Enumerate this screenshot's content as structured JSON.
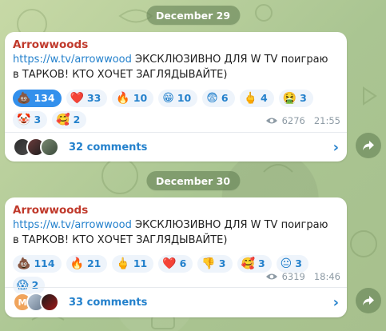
{
  "dates": [
    "December 29",
    "December 30"
  ],
  "posts": [
    {
      "author": "Arrowwoods",
      "link": "https://w.tv/arrowwood",
      "text": " ЭКСКЛЮЗИВНО ДЛЯ W TV поиграю в ТАРКОВ! КТО ХОЧЕТ ЗАГЛЯДЫВАЙТЕ)",
      "reactions": [
        {
          "emoji": "💩",
          "count": "134",
          "active": true,
          "icon": "poop-icon"
        },
        {
          "emoji": "❤️",
          "count": "33",
          "active": false,
          "icon": "heart-icon"
        },
        {
          "emoji": "🔥",
          "count": "10",
          "active": false,
          "icon": "fire-icon"
        },
        {
          "emoji": "😁",
          "count": "10",
          "active": false,
          "icon": "grin-icon"
        },
        {
          "emoji": "😨",
          "count": "6",
          "active": false,
          "icon": "fearful-icon"
        },
        {
          "emoji": "🖕",
          "count": "4",
          "active": false,
          "icon": "middle-finger-icon"
        },
        {
          "emoji": "🤮",
          "count": "3",
          "active": false,
          "icon": "vomit-icon"
        },
        {
          "emoji": "🤡",
          "count": "3",
          "active": false,
          "icon": "clown-icon"
        },
        {
          "emoji": "🥰",
          "count": "2",
          "active": false,
          "icon": "love-face-icon"
        }
      ],
      "views": "6276",
      "time": "21:55",
      "comments": "32 comments"
    },
    {
      "author": "Arrowwoods",
      "link": "https://w.tv/arrowwood",
      "text": " ЭКСКЛЮЗИВНО ДЛЯ W TV поиграю в ТАРКОВ! КТО ХОЧЕТ ЗАГЛЯДЫВАЙТЕ)",
      "reactions": [
        {
          "emoji": "💩",
          "count": "114",
          "active": false,
          "icon": "poop-icon"
        },
        {
          "emoji": "🔥",
          "count": "21",
          "active": false,
          "icon": "fire-icon"
        },
        {
          "emoji": "🖕",
          "count": "11",
          "active": false,
          "icon": "middle-finger-icon"
        },
        {
          "emoji": "❤️",
          "count": "6",
          "active": false,
          "icon": "heart-icon"
        },
        {
          "emoji": "👎",
          "count": "3",
          "active": false,
          "icon": "thumbs-down-icon"
        },
        {
          "emoji": "🥰",
          "count": "3",
          "active": false,
          "icon": "love-face-icon"
        },
        {
          "emoji": "😐",
          "count": "3",
          "active": false,
          "icon": "neutral-face-icon"
        },
        {
          "emoji": "😱",
          "count": "2",
          "active": false,
          "icon": "scream-icon"
        }
      ],
      "views": "6319",
      "time": "18:46",
      "comments": "33 comments",
      "avatar_letter": "M"
    }
  ]
}
